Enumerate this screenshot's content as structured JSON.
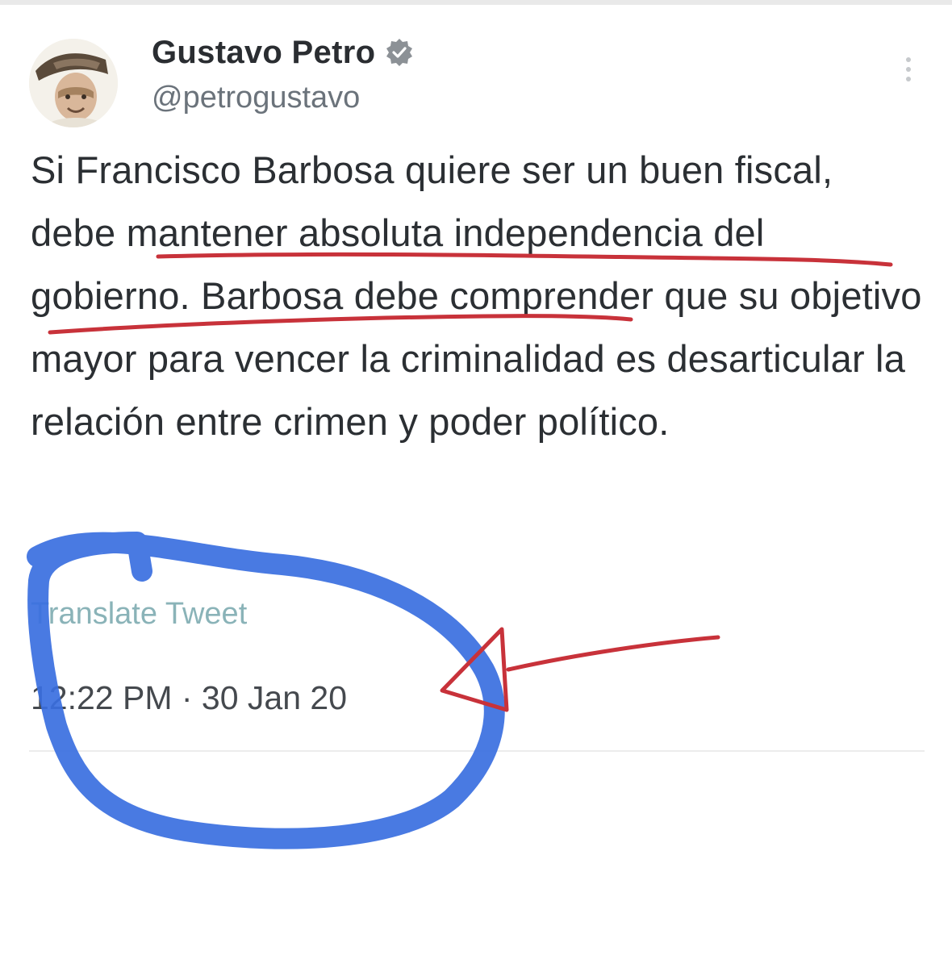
{
  "tweet": {
    "display_name": "Gustavo Petro",
    "handle": "@petrogustavo",
    "text": "Si Francisco Barbosa quiere ser un buen fiscal, debe mantener absoluta independencia del gobierno. Barbosa debe comprender que su objetivo mayor para vencer la criminalidad es desarticular la relación entre crimen y poder político.",
    "translate_label": "Translate Tweet",
    "timestamp": "12:22 PM · 30 Jan 20",
    "verified": true
  },
  "icons": {
    "avatar": "avatar-photo",
    "verified": "verified-badge-icon",
    "more": "more-vertical-icon"
  },
  "colors": {
    "underline": "#c8323a",
    "circle": "#3a6fe0",
    "arrow": "#c8323a",
    "translate_link": "#8ab3b8"
  }
}
